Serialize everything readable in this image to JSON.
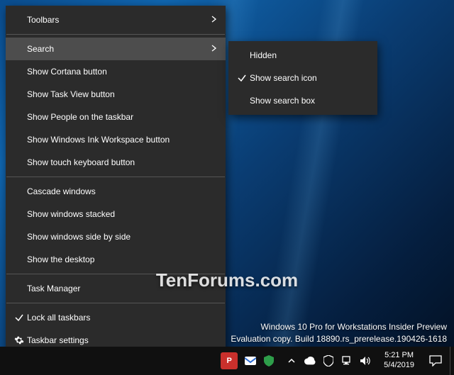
{
  "menu": {
    "items": [
      {
        "label": "Toolbars",
        "submenu": true
      },
      {
        "label": "Search",
        "submenu": true,
        "hover": true
      },
      {
        "label": "Show Cortana button"
      },
      {
        "label": "Show Task View button"
      },
      {
        "label": "Show People on the taskbar"
      },
      {
        "label": "Show Windows Ink Workspace button"
      },
      {
        "label": "Show touch keyboard button"
      }
    ],
    "group2": [
      {
        "label": "Cascade windows"
      },
      {
        "label": "Show windows stacked"
      },
      {
        "label": "Show windows side by side"
      },
      {
        "label": "Show the desktop"
      }
    ],
    "group3": [
      {
        "label": "Task Manager"
      }
    ],
    "group4": [
      {
        "label": "Lock all taskbars",
        "checked": true
      },
      {
        "label": "Taskbar settings",
        "icon": "gear"
      }
    ]
  },
  "submenu_search": {
    "items": [
      {
        "label": "Hidden"
      },
      {
        "label": "Show search icon",
        "checked": true
      },
      {
        "label": "Show search box"
      }
    ]
  },
  "watermark": "TenForums.com",
  "evaluation": {
    "line1": "Windows 10 Pro for Workstations Insider Preview",
    "line2": "Evaluation copy. Build 18890.rs_prerelease.190426-1618"
  },
  "clock": {
    "time": "5:21 PM",
    "date": "5/4/2019"
  },
  "tray_apps": {
    "pinterest": "P",
    "mail_color": "#c9302c"
  }
}
